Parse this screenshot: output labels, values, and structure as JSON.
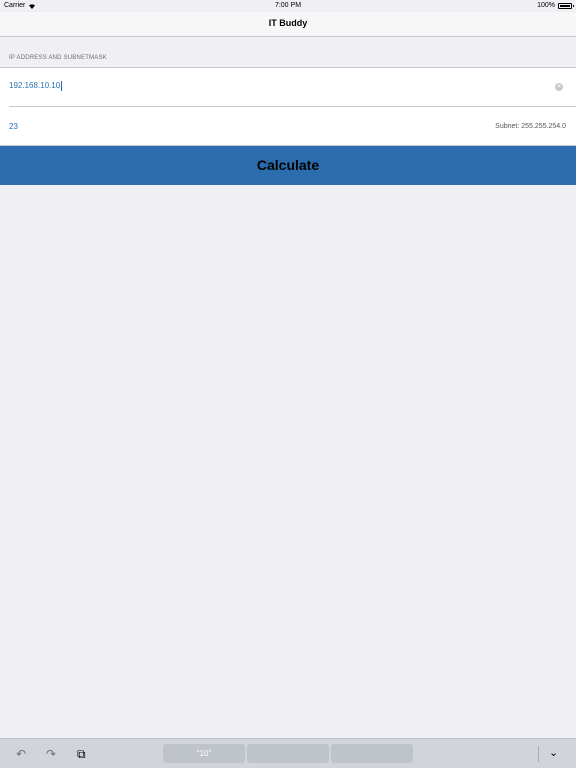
{
  "statusbar": {
    "carrier": "Carrier",
    "wifi_icon": "wifi-icon",
    "time": "7:00 PM",
    "battery": "100%",
    "battery_level": 1.0
  },
  "navbar": {
    "title": "IT Buddy"
  },
  "form": {
    "section_header": "IP ADDRESS AND SUBNETMASK",
    "ip_value": "192.168.10.10",
    "mask_value": "23",
    "subnet_text": "Subnet: 255.255.254.0"
  },
  "calculate_button": {
    "label": "Calculate",
    "color": "#2b6cae"
  },
  "keyboard_bar": {
    "suggestions": [
      "“10”",
      "",
      ""
    ]
  }
}
